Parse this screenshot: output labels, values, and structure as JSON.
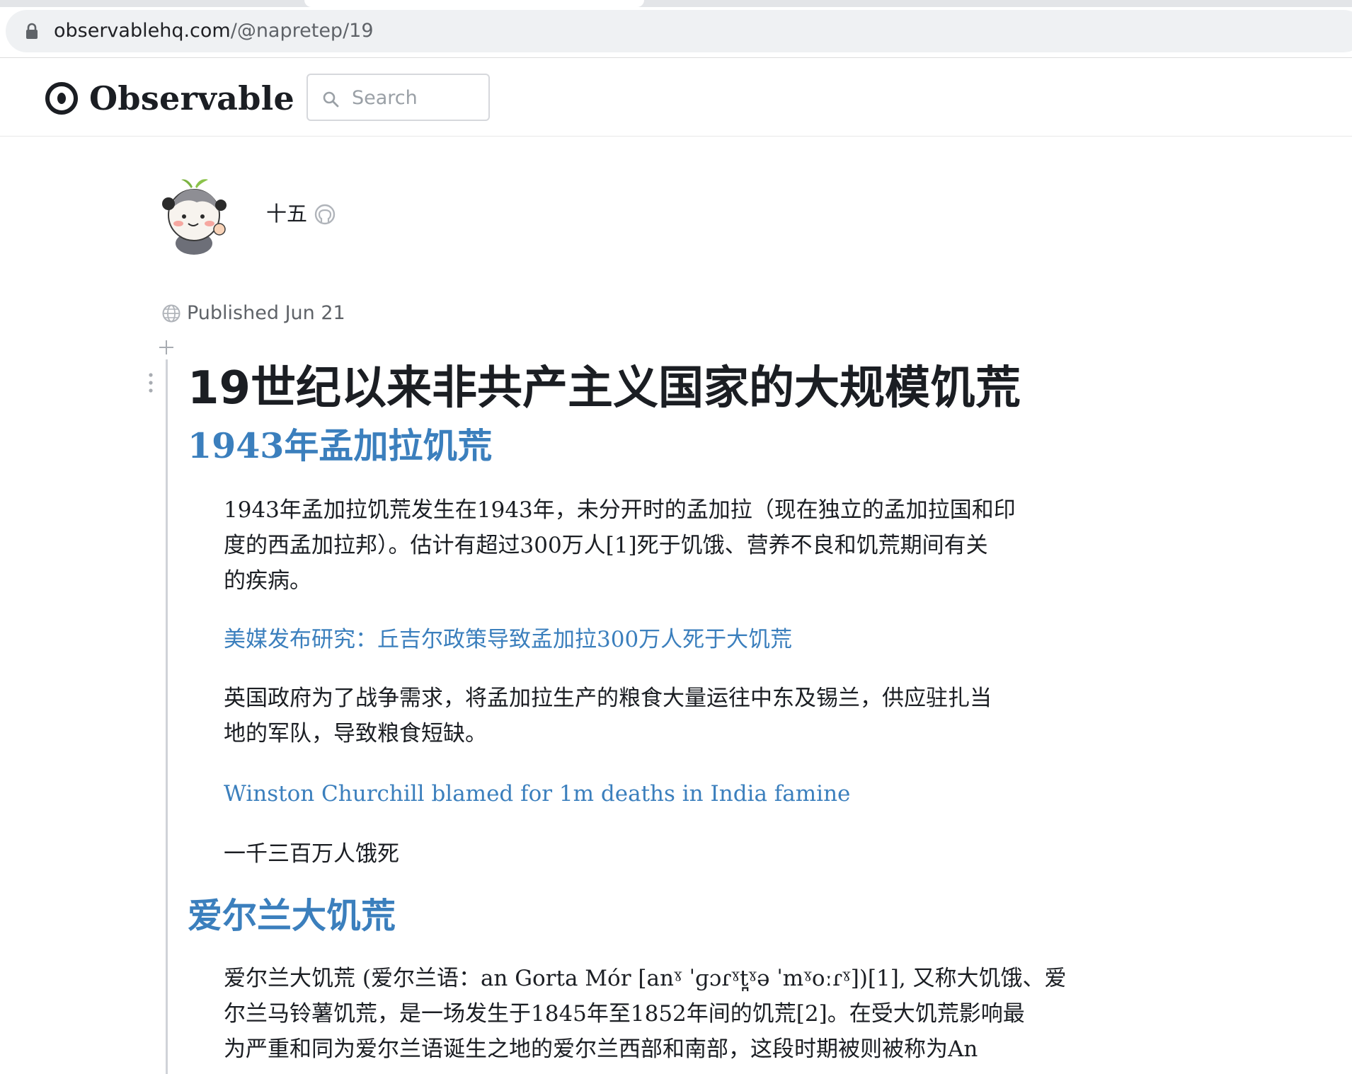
{
  "browser": {
    "url_host": "observablehq.com",
    "url_path": "/@napretep/19"
  },
  "header": {
    "logo_text": "Observable",
    "search_placeholder": "Search"
  },
  "author": {
    "name": "十五"
  },
  "meta": {
    "published": "Published Jun 21"
  },
  "notebook": {
    "title": "19世纪以来非共产主义国家的大规模饥荒",
    "sections": [
      {
        "heading": "1943年孟加拉饥荒",
        "paragraph_1_lines": [
          "1943年孟加拉饥荒发生在1943年，未分开时的孟加拉（现在独立的孟加拉国和印",
          "度的西孟加拉邦）。估计有超过300万人[1]死于饥饿、营养不良和饥荒期间有关",
          "的疾病。"
        ],
        "link_1": "美媒发布研究：丘吉尔政策导致孟加拉300万人死于大饥荒",
        "paragraph_2_lines": [
          "英国政府为了战争需求，将孟加拉生产的粮食大量运往中东及锡兰，供应驻扎当",
          "地的军队，导致粮食短缺。"
        ],
        "link_2": "Winston Churchill blamed for 1m deaths in India famine",
        "paragraph_3": "一千三百万人饿死"
      },
      {
        "heading": "爱尔兰大饥荒",
        "paragraph_1_lines": [
          "爱尔兰大饥荒 (爱尔兰语：an Gorta Mór [anˠ ˈɡɔɾˠt̪ˠə ˈmˠoːɾˠ])[1], 又称大饥饿、爱",
          "尔兰马铃薯饥荒，是一场发生于1845年至1852年间的饥荒[2]。在受大饥荒影响最",
          "为严重和同为爱尔兰语诞生之地的爱尔兰西部和南部，这段时期被则被称为An"
        ]
      }
    ]
  }
}
